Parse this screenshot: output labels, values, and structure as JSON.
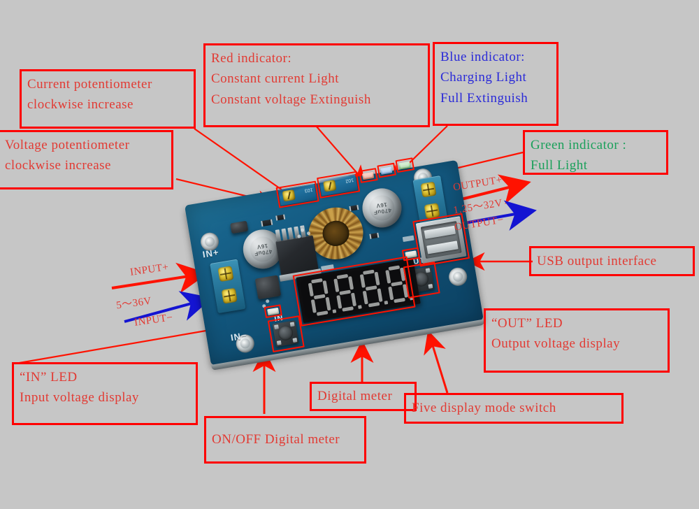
{
  "figure": {
    "subject": "XL4015 5A DC-DC step-down buck converter module with digital voltmeter and USB output",
    "background_color": "#c6c6c6",
    "callout_border_color": "#ff0000",
    "text_red": "#e23a33",
    "text_blue": "#2a2ad8",
    "text_green": "#1aa05a"
  },
  "callouts": [
    {
      "id": "current-pot",
      "lines": [
        "Current potentiometer",
        "clockwise increase"
      ],
      "color": "red"
    },
    {
      "id": "voltage-pot",
      "lines": [
        "Voltage potentiometer",
        "clockwise increase"
      ],
      "color": "red"
    },
    {
      "id": "red-indicator",
      "lines": [
        "Red indicator:",
        "Constant current Light",
        "Constant voltage Extinguish"
      ],
      "color": "red"
    },
    {
      "id": "blue-indicator",
      "lines": [
        "Blue indicator:",
        "Charging Light",
        "Full Extinguish"
      ],
      "color": "blue"
    },
    {
      "id": "green-indicator",
      "lines": [
        "Green indicator :",
        "Full Light"
      ],
      "color": "green"
    },
    {
      "id": "usb-output",
      "lines": [
        "USB output interface"
      ],
      "color": "red"
    },
    {
      "id": "out-led",
      "lines": [
        "“OUT”  LED",
        "Output voltage display"
      ],
      "color": "red"
    },
    {
      "id": "in-led",
      "lines": [
        "“IN”  LED",
        "Input voltage display"
      ],
      "color": "red"
    },
    {
      "id": "onoff-meter",
      "lines": [
        "ON/OFF Digital meter"
      ],
      "color": "red"
    },
    {
      "id": "digital-meter",
      "lines": [
        "Digital meter"
      ],
      "color": "red"
    },
    {
      "id": "mode-switch",
      "lines": [
        "Five display mode switch"
      ],
      "color": "red"
    }
  ],
  "port_labels": {
    "input_plus": "INPUT+",
    "input_range": "5～36V",
    "input_minus": "INPUT−",
    "output_plus": "OUTPUT+",
    "output_range": "1.25～32V",
    "output_minus": "OUTPUT−"
  },
  "board_silkscreen": {
    "in_plus": "IN+",
    "in_minus": "IN−",
    "in_led": "IN",
    "out_led": "OUT",
    "cap_text": "470uF\n16V",
    "pot_current_mark": "103",
    "pot_voltage_mark": "102"
  },
  "display": {
    "digits": [
      "8",
      "8",
      "8",
      "8"
    ],
    "segment_color": "#b9bcbb",
    "background_color": "#0c0c0e"
  },
  "indicator_leds": [
    {
      "name": "red-led",
      "color": "#e9a08c"
    },
    {
      "name": "blue-led",
      "color": "#9cc0ea"
    },
    {
      "name": "green-led",
      "color": "#a6d8a2"
    }
  ]
}
